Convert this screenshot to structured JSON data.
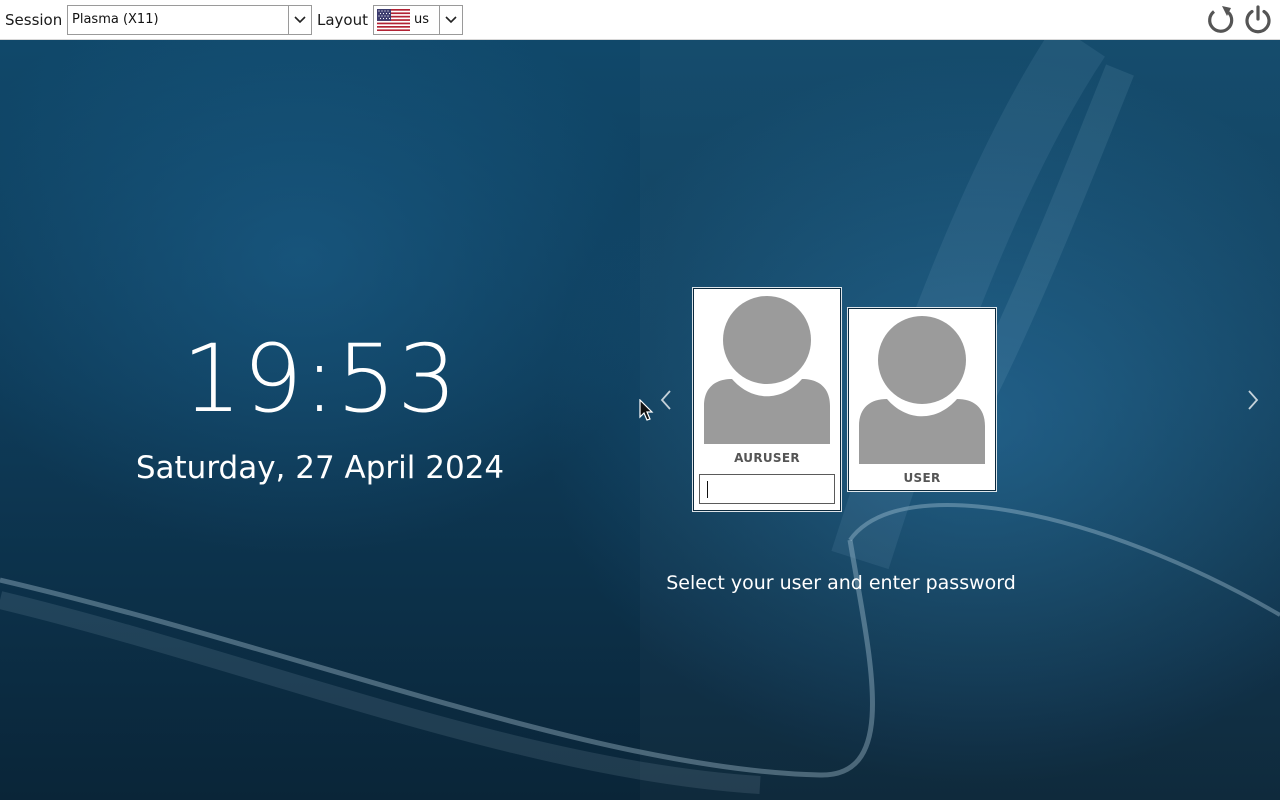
{
  "topbar": {
    "session_label": "Session",
    "session_value": "Plasma (X11)",
    "layout_label": "Layout",
    "layout_value": "us",
    "layout_flag": "us-flag-icon",
    "reboot_icon": "reboot-icon",
    "shutdown_icon": "power-icon"
  },
  "clock": {
    "time": "19:53",
    "date": "Saturday, 27 April 2024"
  },
  "users": [
    {
      "name": "AURUSER",
      "selected": true,
      "password_value": ""
    },
    {
      "name": "USER",
      "selected": false
    }
  ],
  "hint": "Select your user and enter password",
  "colors": {
    "avatar": "#9b9b9b",
    "wallpaper_dark": "#0a2538",
    "wallpaper_mid": "#10486a",
    "text": "#ffffff"
  }
}
